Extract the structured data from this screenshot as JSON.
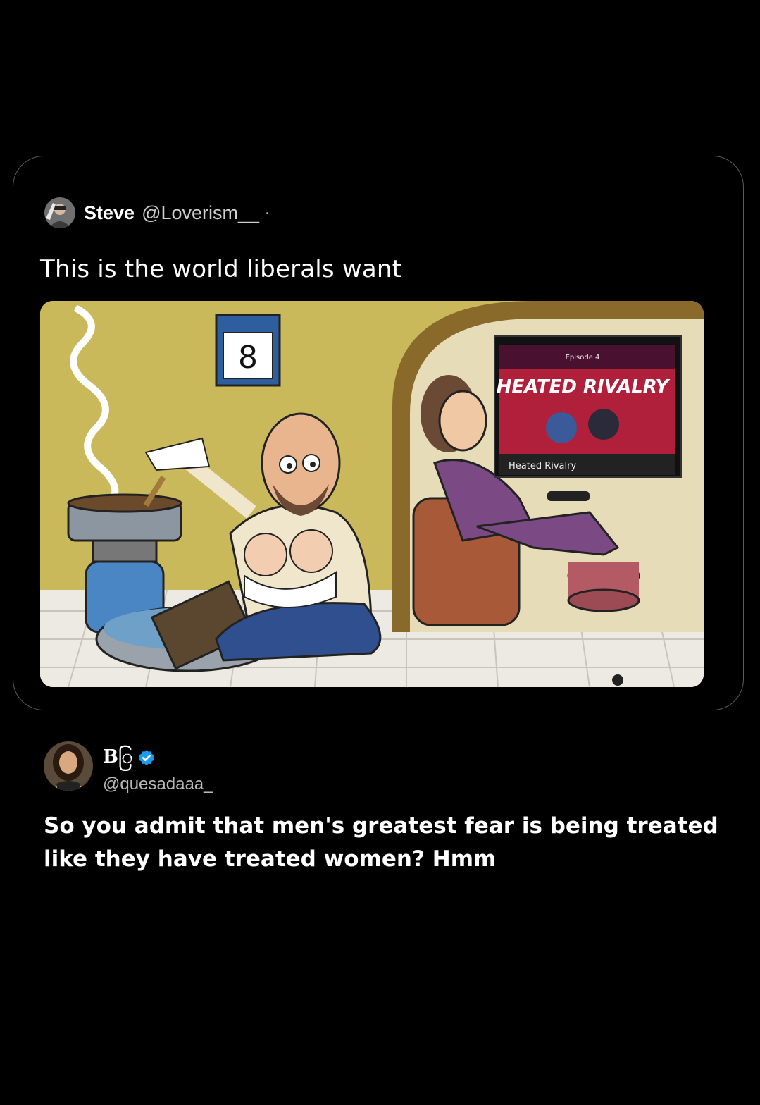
{
  "quoted_post": {
    "author_name": "Steve",
    "author_handle": "@Loverism__",
    "separator": "·",
    "text": "This is the world liberals want",
    "image": {
      "calendar_number": "8",
      "tv_episode": "Episode 4",
      "tv_show_title": "HEATED RIVALRY",
      "tv_caption": "Heated Rivalry"
    }
  },
  "reply": {
    "author_name": "Bြ",
    "author_handle": "@quesadaaa_",
    "text": "So you admit that men's greatest fear is being treated like they have treated women? Hmm"
  },
  "icons": {
    "verified": "verified-badge-icon",
    "avatar_quoted": "user-avatar",
    "avatar_reply": "user-avatar"
  },
  "colors": {
    "background": "#000000",
    "card_border": "#5a5a5a",
    "verified_blue": "#1d9bf0",
    "handle_gray": "#b8b8b8"
  }
}
